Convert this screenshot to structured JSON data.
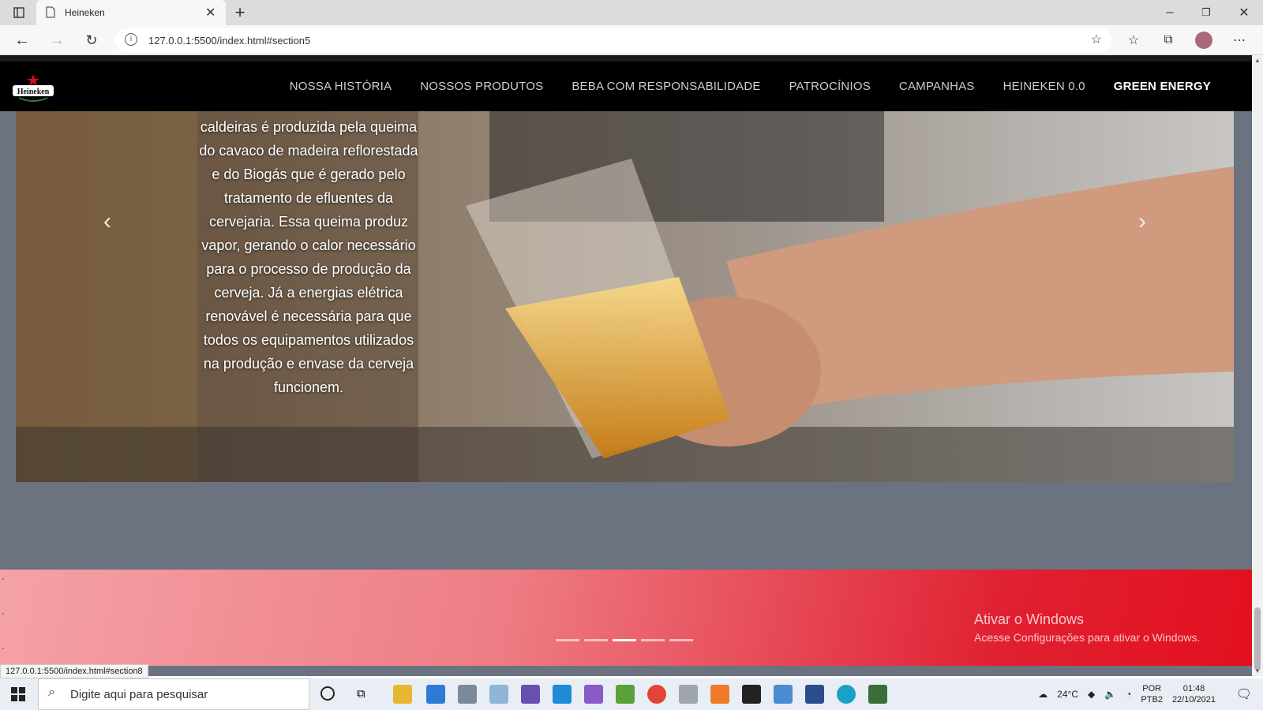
{
  "browser": {
    "tab_title": "Heineken",
    "url": "127.0.0.1:5500/index.html#section5",
    "status_url": "127.0.0.1:5500/index.html#section8"
  },
  "site": {
    "logo_text": "Heineken",
    "nav": [
      {
        "label": "NOSSA HISTÓRIA"
      },
      {
        "label": "NOSSOS PRODUTOS"
      },
      {
        "label": "BEBA COM RESPONSABILIDADE"
      },
      {
        "label": "PATROCÍNIOS"
      },
      {
        "label": "CAMPANHAS"
      },
      {
        "label": "HEINEKEN 0.0"
      },
      {
        "label": "GREEN ENERGY"
      }
    ],
    "active_nav": "GREEN ENERGY",
    "caption": "caldeiras é produzida pela queima do cavaco de madeira reflorestada e do Biogás que é gerado pelo tratamento de efluentes da cervejaria. Essa queima produz vapor, gerando o calor necessário para o processo de produção da cerveja. Já a energias elétrica renovável é necessária para que todos os equipamentos utilizados na produção e envase da cerveja funcionem.",
    "carousel_total": 5,
    "carousel_active": 3,
    "dots": [
      "·",
      "·",
      "·"
    ]
  },
  "watermark": {
    "title": "Ativar o Windows",
    "subtitle": "Acesse Configurações para ativar o Windows."
  },
  "taskbar": {
    "search_placeholder": "Digite aqui para pesquisar",
    "temperature": "24°C",
    "lang1": "POR",
    "lang2": "PTB2",
    "time": "01:48",
    "date": "22/10/2021"
  },
  "colors": {
    "brand_red": "#e3101f",
    "nav_bg": "#000000",
    "page_bg": "#6b7280"
  }
}
